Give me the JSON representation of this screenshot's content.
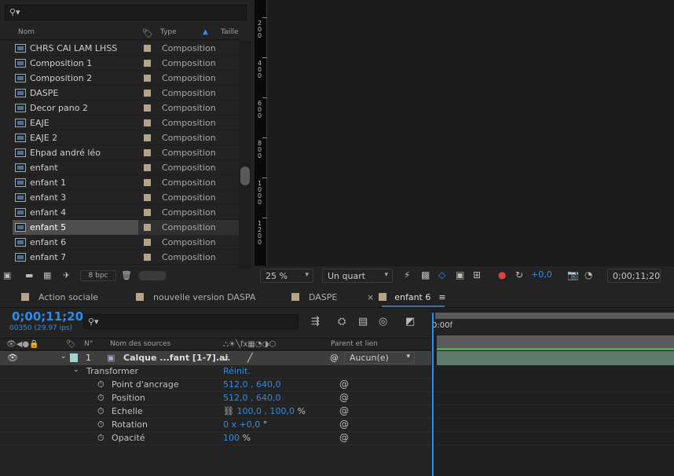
{
  "project": {
    "search_icon": "magnifier-icon",
    "columns": {
      "name": "Nom",
      "type": "Type",
      "size": "Taille"
    },
    "items": [
      {
        "name": "CHRS CAI LAM LHSS",
        "type": "Composition"
      },
      {
        "name": "Composition 1",
        "type": "Composition"
      },
      {
        "name": "Composition 2",
        "type": "Composition"
      },
      {
        "name": "DASPE",
        "type": "Composition"
      },
      {
        "name": "Decor pano 2",
        "type": "Composition"
      },
      {
        "name": "EAJE",
        "type": "Composition"
      },
      {
        "name": "EAJE 2",
        "type": "Composition"
      },
      {
        "name": "Ehpad andré léo",
        "type": "Composition"
      },
      {
        "name": "enfant",
        "type": "Composition"
      },
      {
        "name": "enfant 1",
        "type": "Composition"
      },
      {
        "name": "enfant 3",
        "type": "Composition"
      },
      {
        "name": "enfant 4",
        "type": "Composition"
      },
      {
        "name": "enfant 5",
        "type": "Composition",
        "selected": true
      },
      {
        "name": "enfant 6",
        "type": "Composition"
      },
      {
        "name": "enfant 7",
        "type": "Composition"
      }
    ],
    "bpc": "8 bpc"
  },
  "viewer": {
    "ruler_labels": [
      "200",
      "400",
      "600",
      "800",
      "1000",
      "1200"
    ],
    "zoom": "25 %",
    "resolution": "Un quart",
    "exposure": "+0,0",
    "timecode": "0;00;11;20"
  },
  "tabs": [
    {
      "label": "Action sociale"
    },
    {
      "label": "nouvelle version DASPA"
    },
    {
      "label": "DASPE"
    },
    {
      "label": "enfant 6",
      "active": true
    }
  ],
  "timeline": {
    "timecode": "0;00;11;20",
    "fps": "00350 (29.97 ips)",
    "ruler_start": "0:00f",
    "columns": {
      "num": "N°",
      "source": "Nom des sources",
      "parent": "Parent et lien"
    },
    "layer": {
      "num": "1",
      "name": "Calque ...fant [1-7].ai",
      "parent": "Aucun(e)"
    },
    "transform": {
      "label": "Transformer",
      "reset": "Réinit."
    },
    "properties": [
      {
        "name": "Point d'ancrage",
        "value": "512,0 , 640,0",
        "unit": ""
      },
      {
        "name": "Position",
        "value": "512,0 , 640,0",
        "unit": ""
      },
      {
        "name": "Echelle",
        "value": "100,0 , 100,0",
        "unit": "%"
      },
      {
        "name": "Rotation",
        "value": "0 x +0,0",
        "unit": "°"
      },
      {
        "name": "Opacité",
        "value": "100",
        "unit": "%"
      }
    ]
  },
  "colors": {
    "accent": "#2d8ceb",
    "label": "#b5a488",
    "clip": "#5e7a6a",
    "bar": "#3fae49"
  }
}
